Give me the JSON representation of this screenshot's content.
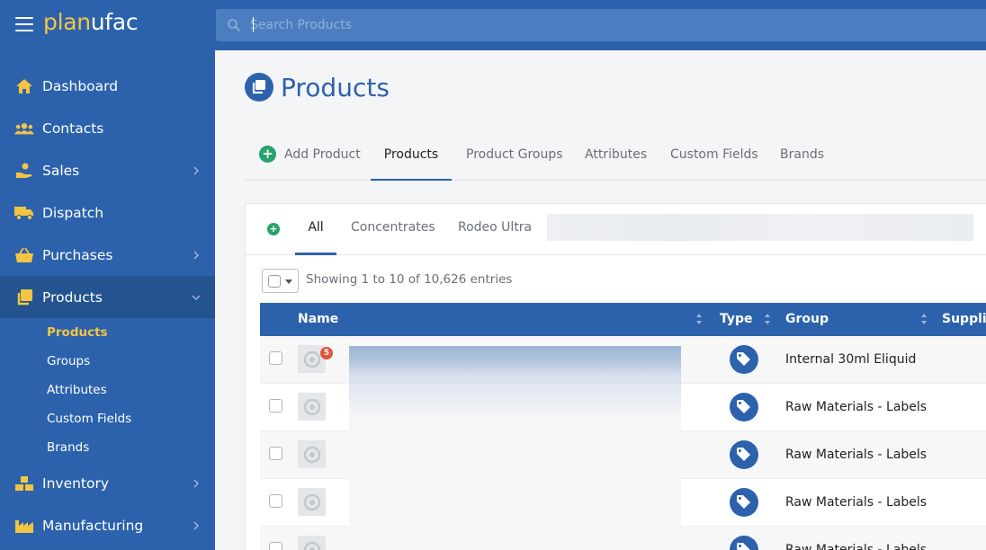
{
  "app": {
    "logo_part1": "plan",
    "logo_part2": "ufac"
  },
  "search": {
    "placeholder": "Search Products"
  },
  "sidebar": {
    "items": [
      {
        "label": "Dashboard",
        "icon": "home-icon"
      },
      {
        "label": "Contacts",
        "icon": "users-icon"
      },
      {
        "label": "Sales",
        "icon": "hand-coin-icon"
      },
      {
        "label": "Dispatch",
        "icon": "truck-icon"
      },
      {
        "label": "Purchases",
        "icon": "basket-icon"
      },
      {
        "label": "Products",
        "icon": "copy-icon"
      },
      {
        "label": "Inventory",
        "icon": "boxes-icon"
      },
      {
        "label": "Manufacturing",
        "icon": "factory-icon"
      }
    ],
    "subitems": [
      {
        "label": "Products"
      },
      {
        "label": "Groups"
      },
      {
        "label": "Attributes"
      },
      {
        "label": "Custom Fields"
      },
      {
        "label": "Brands"
      }
    ]
  },
  "page": {
    "title": "Products"
  },
  "tabs": [
    {
      "label": "Add Product"
    },
    {
      "label": "Products"
    },
    {
      "label": "Product Groups"
    },
    {
      "label": "Attributes"
    },
    {
      "label": "Custom Fields"
    },
    {
      "label": "Brands"
    }
  ],
  "subtabs": [
    {
      "label": "All"
    },
    {
      "label": "Concentrates"
    },
    {
      "label": "Rodeo Ultra"
    }
  ],
  "table": {
    "entries_text": "Showing 1 to 10 of 10,626 entries",
    "columns": {
      "name": "Name",
      "type": "Type",
      "group": "Group",
      "supplier": "Supplie"
    },
    "rows": [
      {
        "group": "Internal 30ml Eliquid",
        "badge": "5"
      },
      {
        "group": "Raw Materials - Labels"
      },
      {
        "group": "Raw Materials - Labels"
      },
      {
        "group": "Raw Materials - Labels"
      },
      {
        "group": "Raw Materials - Labels"
      }
    ]
  },
  "colors": {
    "primary": "#2c62ac",
    "accent": "#f4c542",
    "success": "#28a36a",
    "badge": "#e0543a"
  }
}
